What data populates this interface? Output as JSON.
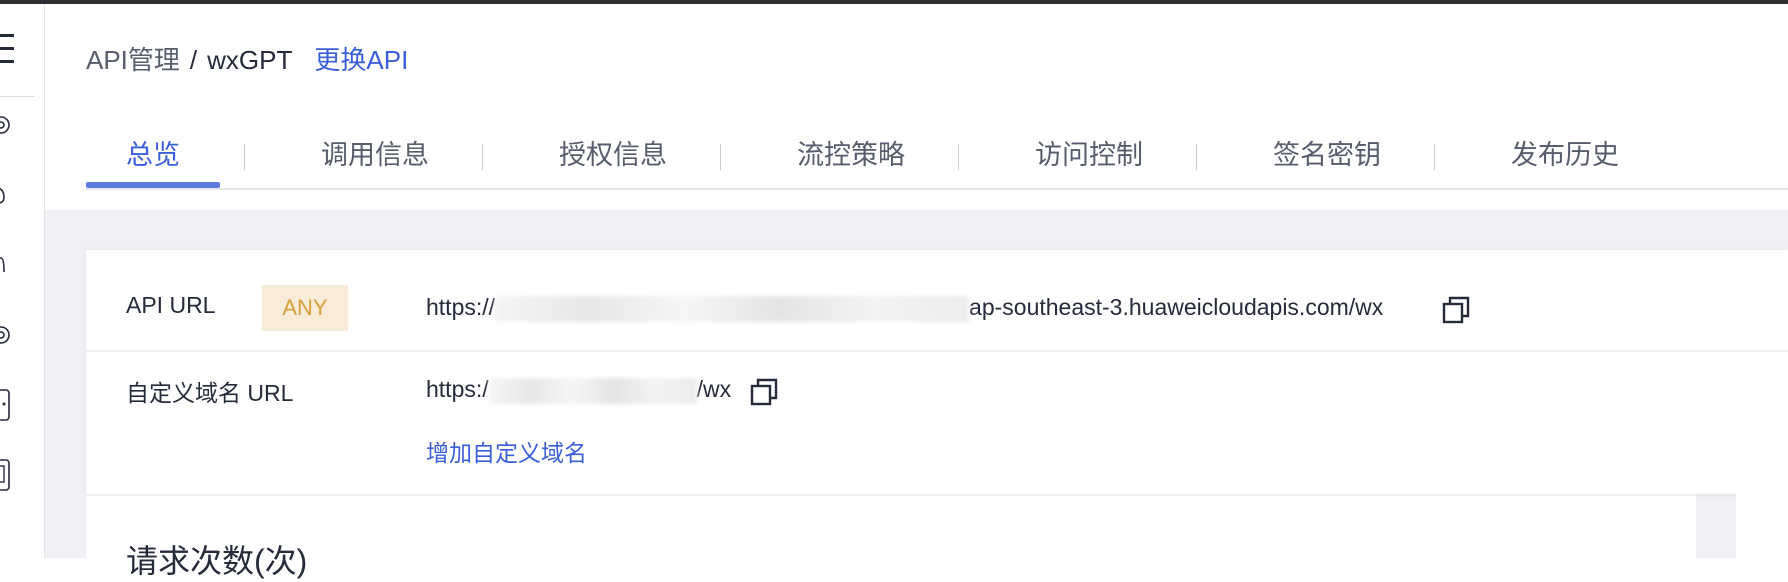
{
  "header": {
    "breadcrumb_root": "API管理",
    "breadcrumb_separator": "/",
    "api_name": "wxGPT",
    "change_api_label": "更换API"
  },
  "tabs": [
    {
      "label": "总览",
      "active": true
    },
    {
      "label": "调用信息",
      "active": false
    },
    {
      "label": "授权信息",
      "active": false
    },
    {
      "label": "流控策略",
      "active": false
    },
    {
      "label": "访问控制",
      "active": false
    },
    {
      "label": "签名密钥",
      "active": false
    },
    {
      "label": "发布历史",
      "active": false
    }
  ],
  "overview": {
    "api_url_label": "API URL",
    "method_badge": "ANY",
    "api_url_prefix": "https://",
    "api_url_suffix": "ap-southeast-3.huaweicloudapis.com/wx",
    "custom_domain_label": "自定义域名 URL",
    "custom_url_prefix": "https:/",
    "custom_url_suffix": "/wx",
    "add_custom_domain_link": "增加自定义域名"
  },
  "stats": {
    "request_count_title": "请求次数(次)"
  },
  "sidebar": {
    "icons": [
      "menu-icon",
      "service-icon",
      "cloud-icon",
      "function-icon",
      "settings-icon",
      "document-icon",
      "toolkit-icon"
    ]
  },
  "colors": {
    "accent": "#3b5fd9",
    "tab_underline": "#5e7ce0",
    "badge_bg": "#f8ecd9",
    "badge_text": "#d8a03a",
    "content_bg": "#f0f1f4"
  }
}
